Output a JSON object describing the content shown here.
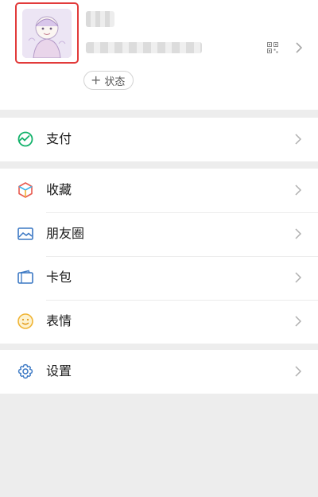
{
  "profile": {
    "status_plus": "+",
    "status_label": "状态"
  },
  "menu": {
    "pay": "支付",
    "favorites": "收藏",
    "moments": "朋友圈",
    "cards": "卡包",
    "stickers": "表情",
    "settings": "设置"
  },
  "colors": {
    "highlight_border": "#e23b3b",
    "pay_green": "#13b26b",
    "settings_blue": "#3b78c4",
    "stickers_yellow": "#f0b434"
  },
  "icons": {
    "pay": "pay-icon",
    "favorites": "cube-icon",
    "moments": "photo-icon",
    "cards": "wallet-icon",
    "stickers": "smiley-icon",
    "settings": "gear-icon",
    "qr": "qr-code-icon",
    "chevron": "chevron-right-icon"
  }
}
